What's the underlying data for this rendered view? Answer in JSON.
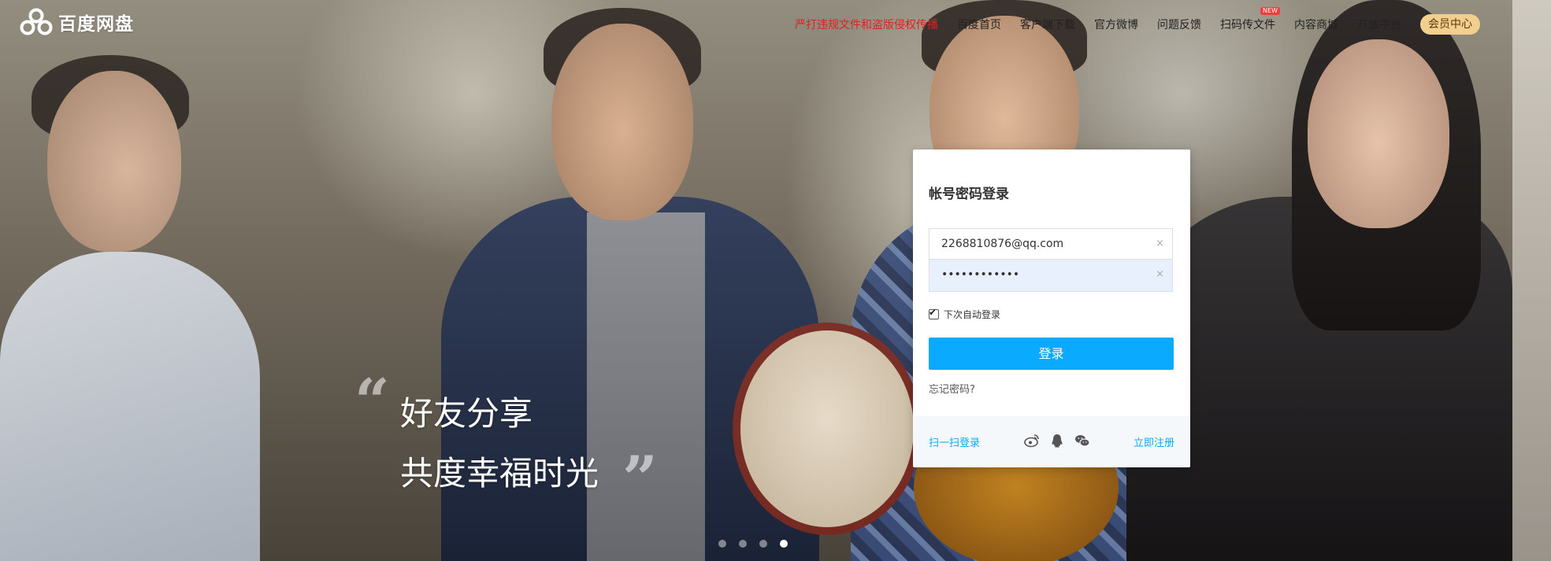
{
  "header": {
    "logo_text": "百度网盘",
    "nav": {
      "notice": "严打违规文件和盗版侵权传播",
      "home": "百度首页",
      "client_download": "客户端下载",
      "weibo": "官方微博",
      "feedback": "问题反馈",
      "scan_transfer": "扫码传文件",
      "scan_transfer_badge": "NEW",
      "content_mall": "内容商城",
      "open_platform": "开放平台"
    },
    "vip_button": "会员中心"
  },
  "slogan": {
    "quote_open": "“",
    "quote_close": "”",
    "line1": "好友分享",
    "line2": "共度幸福时光"
  },
  "carousel": {
    "slide_count": 4,
    "active_index": 3
  },
  "login": {
    "title": "帐号密码登录",
    "username_value": "2268810876@qq.com",
    "password_value": "••••••••••••",
    "clear_symbol": "×",
    "remember_label": "下次自动登录",
    "remember_checked": true,
    "submit_label": "登录",
    "forgot_label": "忘记密码?",
    "qr_login_label": "扫一扫登录",
    "social_icons": [
      "weibo-icon",
      "qq-icon",
      "wechat-icon"
    ],
    "register_label": "立即注册"
  },
  "colors": {
    "primary_blue": "#09aaff",
    "notice_red": "#e02020",
    "vip_gold": "#f2cf8d",
    "password_field_bg": "#e8f0fe"
  }
}
